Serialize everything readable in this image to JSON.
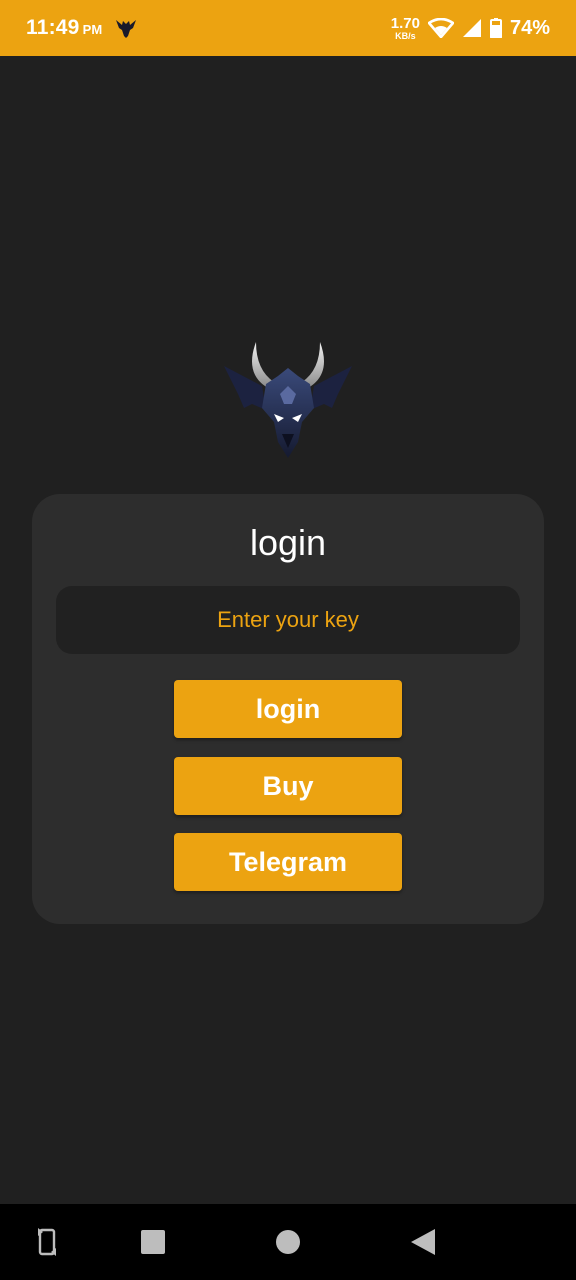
{
  "status_bar": {
    "time": "11:49",
    "ampm": "PM",
    "net_speed_value": "1.70",
    "net_speed_unit": "KB/s",
    "battery": "74%",
    "color": "#ECA311",
    "icons": [
      "dragon-logo-icon",
      "wifi-icon",
      "signal-icon",
      "battery-icon"
    ]
  },
  "logo": {
    "icon": "dragon-logo-icon"
  },
  "card": {
    "title": "login",
    "key_input": {
      "placeholder": "Enter your key",
      "value": ""
    },
    "buttons": {
      "login": "login",
      "buy": "Buy",
      "telegram": "Telegram"
    }
  },
  "nav_bar": {
    "icons": [
      "rotate-icon",
      "recent-apps-icon",
      "home-icon",
      "back-icon"
    ]
  },
  "colors": {
    "accent": "#ECA311",
    "background": "#202020",
    "card": "#2d2d2d",
    "input": "#212121"
  }
}
